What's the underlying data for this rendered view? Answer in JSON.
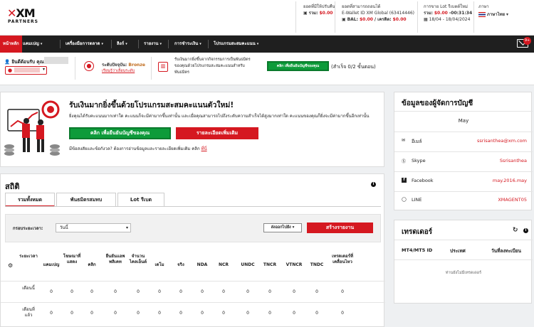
{
  "brand": {
    "logo": "XM",
    "sub": "PARTNERS"
  },
  "header": {
    "commission": {
      "title": "ยอดที่มีให้ปรับคืน",
      "total_label": "รวม:",
      "total_value": "$0.00"
    },
    "wallet": {
      "title": "ยอดที่สามารถถอนได้",
      "wallet_id": "E-Wallet ID XM Global (63414446)",
      "bal_label": "BAL:",
      "bal_value": "$0.00",
      "credit_label": "/ เครดิต:",
      "credit_value": "$0.00"
    },
    "lot": {
      "title": "การขาย Lot รีเบตต์ใหม่",
      "total_label": "รวม:",
      "total_value": "$0.00",
      "time": "-00:31:34",
      "date_range": "18/04 - 18/04/2024"
    },
    "language": {
      "title": "ภาษา",
      "value": "ภาษาไทย"
    }
  },
  "nav": {
    "items": [
      "หน้าหลัก",
      "แคมเปญ",
      "เครื่องมือการตลาด",
      "ลิงก์",
      "รายงาน",
      "การชำระเงิน",
      "โปรแกรมสะสมคะแนน"
    ],
    "mail_badge": "9+"
  },
  "welcome": {
    "greeting": "ยินดีต้อนรับ คุณ",
    "account": "...",
    "level_label": "ระดับปัจจุบัน:",
    "level_value": "Bronze",
    "learn_more": "เรียนรู้ว่าเลื่อนระดับ",
    "promo_text": "รับเงินมากยิ่งขึ้นจากกิจกรรมการเป็นพันธมิตรของคุณด้วยโปรแกรมสะสมคะแนนสำหรับพันธมิตร",
    "promo_button": "คลิก เพื่อยืนยันบัญชีของคุณ",
    "success": "(สำเร็จ 0/2 ขั้นตอน)"
  },
  "promo": {
    "title": "รับเงินมากยิ่งขึ้นด้วยโปรแกรมสะสมคะแนนตัวใหม่!",
    "body": "ยิ่งคุณได้รับคะแนนมากเท่าใด คะแนนก็จะมีค่ามากขึ้นเท่านั้น และเมื่อคุณสามารถไปถึงระดับความสำเร็จได้สูงมากเท่าใด คะแนนของคุณก็ยิ่งจะมีค่ามากขึ้นอีกเท่านั้น",
    "verify_button": "คลิก เพื่อยืนยันบัญชีของคุณ",
    "details_button": "รายละเอียดเพิ่มเติม",
    "note_text": "มีข้อสงสัยและข้อกังวล? ต้องการอ่านข้อมูลและรายละเอียดเพิ่มเติม คลิก",
    "note_link": "ที่นี่"
  },
  "account_manager": {
    "title": "ข้อมูลของผู้จัดการบัญชี",
    "name": "May",
    "rows": [
      {
        "label": "อีเมล์",
        "value": "ssrisanthea@xm.com",
        "icon": "envelope-icon"
      },
      {
        "label": "Skype",
        "value": "Ssrisanthea",
        "icon": "skype-icon"
      },
      {
        "label": "Facebook",
        "value": "may.2016.may",
        "icon": "facebook-icon"
      },
      {
        "label": "LINE",
        "value": "XMAGENT05",
        "icon": "chat-icon"
      }
    ]
  },
  "traders": {
    "title": "เทรดเดอร์",
    "cols": [
      "MT4/MT5 ID",
      "ประเทศ",
      "วันที่ลงทะเบียน"
    ],
    "empty": "ท่านยังไม่มีเทรดเดอร์"
  },
  "stats": {
    "title": "สถิติ",
    "tabs": [
      "รวมทั้งหมด",
      "พันธมิตรสมทบ",
      "Lot รีเบต"
    ],
    "period_label": "กรอบระยะเวลา:",
    "period_value": "วันนี้",
    "export_button": "ส่งออกไปยัง",
    "create_button": "สร้างรายงาน",
    "headers": [
      "ระยะเวลา",
      "แคมเปญ",
      "โฆษณาที่แสดง",
      "คลิก",
      "ยืนยันแอพพลิเคท",
      "จำนวนไคลเอ็นต์",
      "เดโม",
      "จริง",
      "NDA",
      "NCR",
      "UNDC",
      "TNCR",
      "VTNCR",
      "TNDC",
      "เทรดเดอร์ที่เคลื่อนไหว"
    ],
    "rows": [
      {
        "period": "เดือนนี้",
        "values": [
          "0",
          "0",
          "0",
          "0",
          "0",
          "0",
          "0",
          "0",
          "0",
          "0",
          "0",
          "0",
          "0",
          "0"
        ]
      },
      {
        "period": "เดือนที่แล้ว",
        "values": [
          "0",
          "0",
          "0",
          "0",
          "0",
          "0",
          "0",
          "0",
          "0",
          "0",
          "0",
          "0",
          "0",
          "0"
        ]
      }
    ]
  }
}
